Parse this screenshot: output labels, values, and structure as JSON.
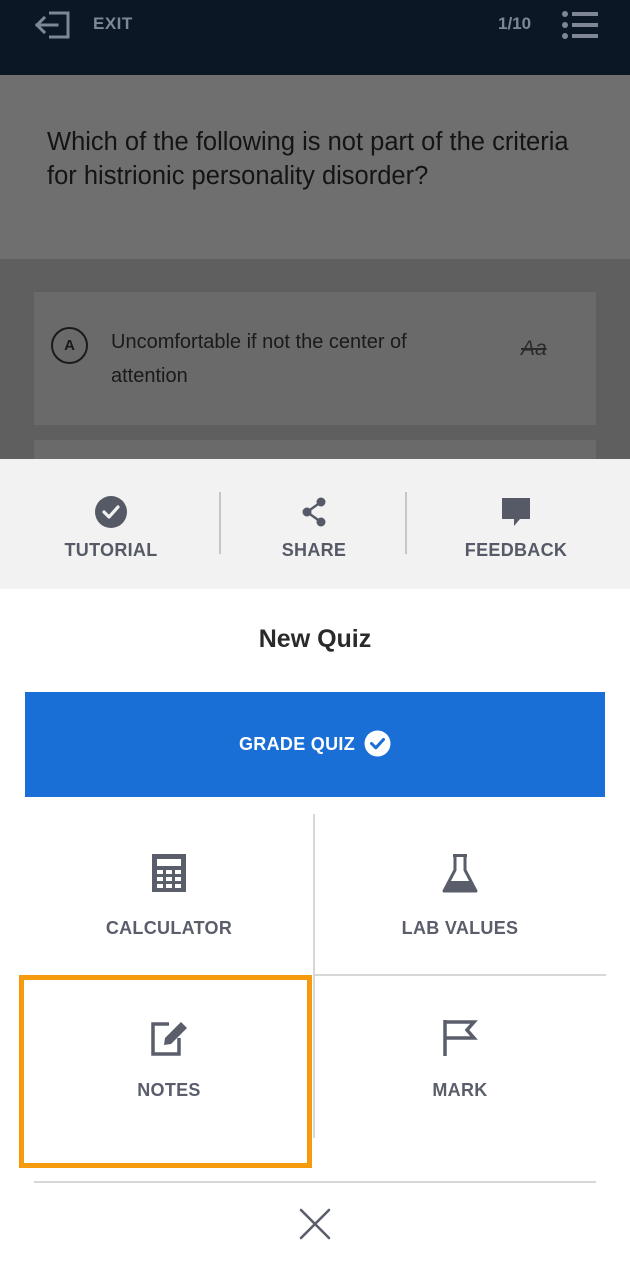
{
  "header": {
    "exit_label": "EXIT",
    "exit_icon": "exit-icon",
    "progress": "1/10",
    "menu_icon": "question-list-icon"
  },
  "question": {
    "text": "Which of the following is not part of the criteria for histrionic personality disorder?"
  },
  "answers": [
    {
      "letter": "A",
      "text": "Uncomfortable if not the center of attention",
      "strike_icon_text": "Aa"
    }
  ],
  "actions": [
    {
      "label": "TUTORIAL",
      "icon": "check-circle-icon"
    },
    {
      "label": "SHARE",
      "icon": "share-icon"
    },
    {
      "label": "FEEDBACK",
      "icon": "feedback-icon"
    }
  ],
  "sheet": {
    "title": "New Quiz",
    "grade_button": "GRADE QUIZ",
    "tools": [
      {
        "label": "CALCULATOR",
        "icon": "calculator-icon"
      },
      {
        "label": "LAB VALUES",
        "icon": "flask-icon"
      },
      {
        "label": "NOTES",
        "icon": "edit-note-icon",
        "highlighted": true
      },
      {
        "label": "MARK",
        "icon": "flag-icon"
      }
    ],
    "close_icon": "close-icon"
  },
  "colors": {
    "topbar": "#0b1725",
    "accent_blue": "#1a6fd6",
    "highlight_orange": "#f59a0c",
    "action_bar": "#f2f2f2",
    "icon_gray": "#5a5e6b"
  }
}
